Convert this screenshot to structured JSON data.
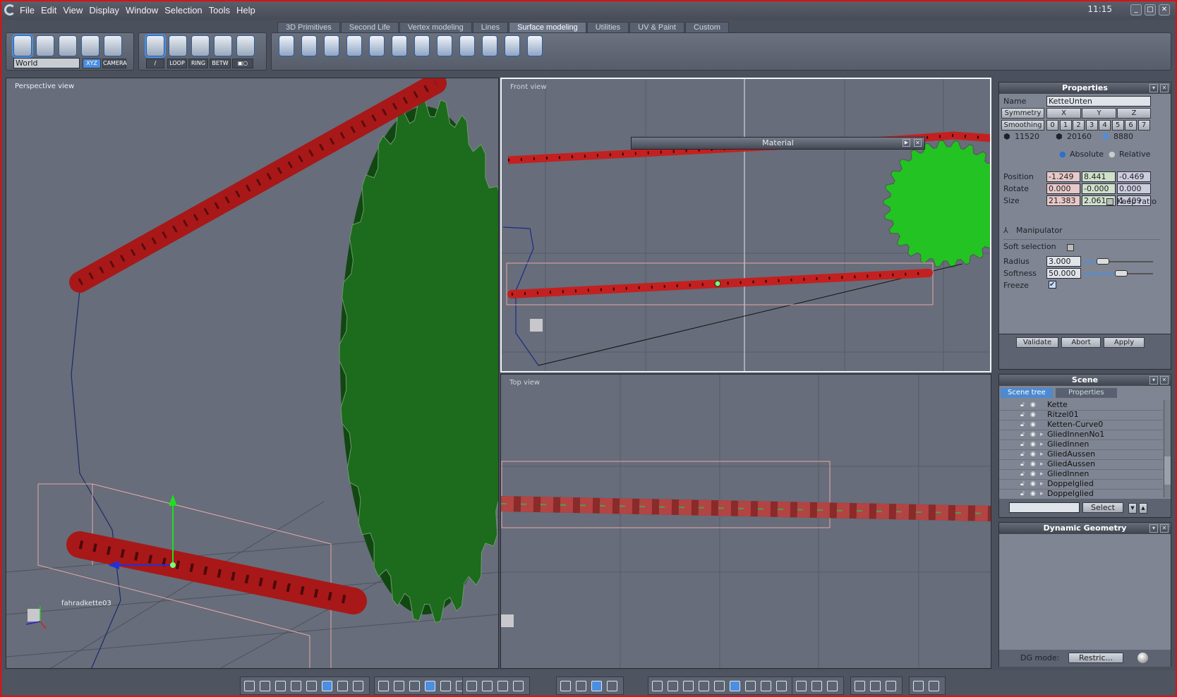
{
  "menu": {
    "items": [
      "File",
      "Edit",
      "View",
      "Display",
      "Window",
      "Selection",
      "Tools",
      "Help"
    ],
    "clock": "11:15"
  },
  "tabs": [
    {
      "label": "3D Primitives"
    },
    {
      "label": "Second Life"
    },
    {
      "label": "Vertex modeling"
    },
    {
      "label": "Lines"
    },
    {
      "label": "Surface modeling",
      "active": true
    },
    {
      "label": "Utilities"
    },
    {
      "label": "UV & Paint"
    },
    {
      "label": "Custom"
    }
  ],
  "toolbar": {
    "space": "World",
    "xyz": "XYZ",
    "camera": "CAMERA",
    "loop": "LOOP",
    "ring": "RING",
    "betw": "BETW"
  },
  "viewports": {
    "perspective": {
      "label": "Perspective view",
      "object": "fahradkette03"
    },
    "front": {
      "label": "Front view"
    },
    "top": {
      "label": "Top view"
    }
  },
  "material_dialog": {
    "title": "Material"
  },
  "properties": {
    "title": "Properties",
    "name_label": "Name",
    "name_value": "KetteUnten",
    "symmetry_label": "Symmetry",
    "symmetry_axes": [
      "X",
      "Y",
      "Z"
    ],
    "smoothing_label": "Smoothing",
    "smoothing_levels": [
      "0",
      "1",
      "2",
      "3",
      "4",
      "5",
      "6",
      "7"
    ],
    "counts": [
      "11520",
      "20160",
      "8880"
    ],
    "absolute": "Absolute",
    "relative": "Relative",
    "position_label": "Position",
    "position": [
      "-1.249",
      "8.441",
      "-0.469"
    ],
    "rotate_label": "Rotate",
    "rotate": [
      "0.000",
      "-0.000",
      "0.000"
    ],
    "size_label": "Size",
    "size": [
      "21.383",
      "2.061",
      "1.409"
    ],
    "keep_ratio": "Keep ratio",
    "manipulator": "Manipulator",
    "soft_selection": "Soft selection",
    "radius_label": "Radius",
    "radius": "3.000",
    "softness_label": "Softness",
    "softness": "50.000",
    "freeze_label": "Freeze",
    "validate": "Validate",
    "abort": "Abort",
    "apply": "Apply"
  },
  "scene": {
    "title": "Scene",
    "tabs": [
      "Scene tree",
      "Properties"
    ],
    "items": [
      {
        "name": "Kette"
      },
      {
        "name": "Ritzel01"
      },
      {
        "name": "Ketten-Curve0"
      },
      {
        "name": "GliedInnenNo1"
      },
      {
        "name": "GliedInnen"
      },
      {
        "name": "GliedAussen"
      },
      {
        "name": "GliedAussen"
      },
      {
        "name": "GliedInnen"
      },
      {
        "name": "Doppelglied"
      },
      {
        "name": "Doppelglied"
      }
    ],
    "select": "Select"
  },
  "dynamic_geometry": {
    "title": "Dynamic Geometry",
    "mode_label": "DG mode:",
    "mode_value": "Restric..."
  },
  "colors": {
    "chain": "#c42020",
    "gear_dark": "#1d6b1d",
    "gear_bright": "#22c322",
    "accent": "#4c8ee0"
  }
}
